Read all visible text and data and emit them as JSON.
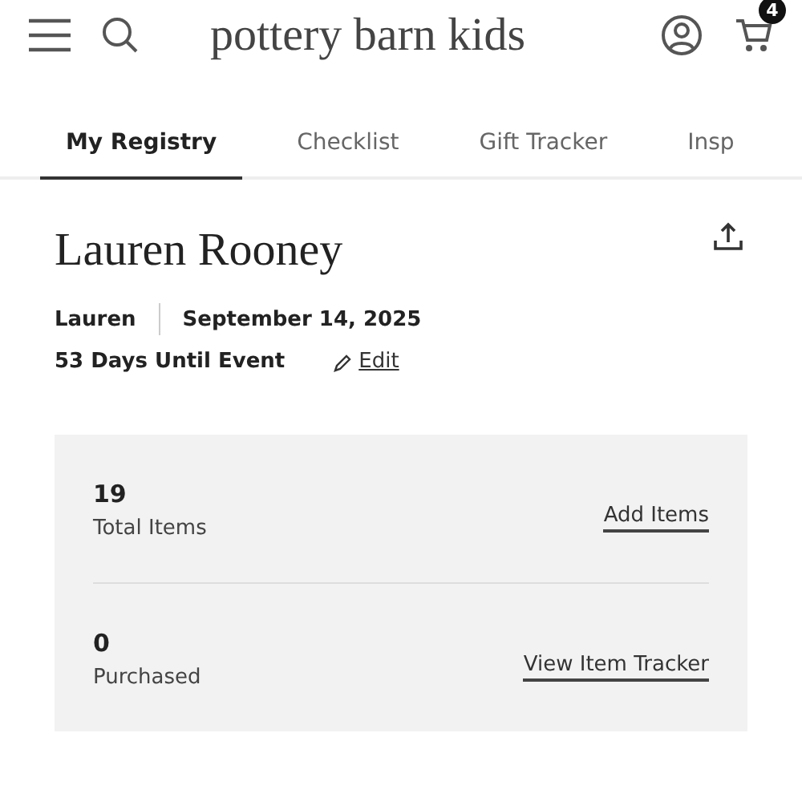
{
  "header": {
    "logo": "pottery barn kids",
    "cart_count": "4"
  },
  "tabs": [
    {
      "label": "My Registry",
      "selected": true
    },
    {
      "label": "Checklist",
      "selected": false
    },
    {
      "label": "Gift Tracker",
      "selected": false
    },
    {
      "label": "Insp",
      "selected": false
    }
  ],
  "registry": {
    "name": "Lauren Rooney",
    "owner": "Lauren",
    "date": "September 14, 2025",
    "countdown": "53 Days Until Event",
    "edit_link": "Edit"
  },
  "stats": [
    {
      "value": "19",
      "label": "Total Items",
      "link": "Add Items"
    },
    {
      "value": "0",
      "label": "Purchased",
      "link": "View Item Tracker"
    }
  ]
}
